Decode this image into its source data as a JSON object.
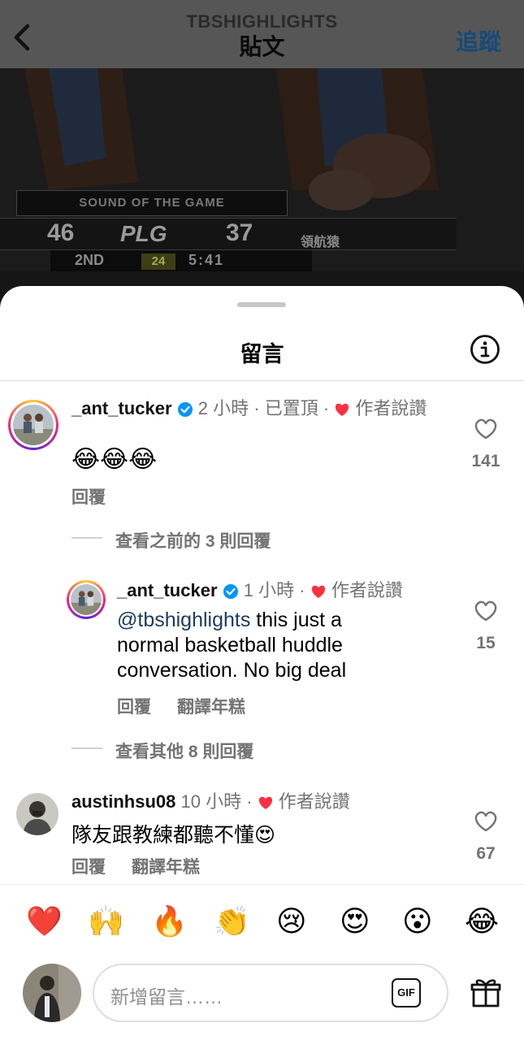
{
  "header": {
    "username": "TBSHIGHLIGHTS",
    "title": "貼文",
    "follow": "追蹤"
  },
  "video": {
    "banner": "SOUND OF THE GAME",
    "score_left": "46",
    "league": "PLG",
    "score_right": "37",
    "team_right": "領航猿",
    "period": "2ND",
    "shot_clock": "24",
    "game_clock": "5:41"
  },
  "sheet": {
    "title": "留言"
  },
  "comments": [
    {
      "username": "_ant_tucker",
      "time": "2 小時",
      "pinned": "已置頂",
      "liked_by_author": "作者說讚",
      "text": "😂😂😂",
      "reply": "回覆",
      "likes": "141",
      "view_previous": "查看之前的 3 則回覆"
    },
    {
      "username": "_ant_tucker",
      "time": "1 小時",
      "liked_by_author": "作者說讚",
      "mention": "@tbshighlights",
      "text_line1": " this just a",
      "text_line2": "normal basketball huddle",
      "text_line3": "conversation. No big deal",
      "reply": "回覆",
      "translate": "翻譯年糕",
      "likes": "15",
      "view_more": "查看其他 8 則回覆"
    },
    {
      "username": "austinhsu08",
      "time": "10 小時",
      "liked_by_author": "作者說讚",
      "text": "隊友跟教練都聽不懂😍",
      "reply": "回覆",
      "translate": "翻譯年糕",
      "likes": "67"
    }
  ],
  "emoji_bar": [
    "❤️",
    "🙌",
    "🔥",
    "👏",
    "😢",
    "😍",
    "😮",
    "😂"
  ],
  "composer": {
    "placeholder": "新增留言……",
    "gif": "GIF"
  },
  "colors": {
    "heart_red": "#ff3040",
    "verified_blue": "#0095f6",
    "mention_blue": "#1c3a5e",
    "secondary_gray": "#737373"
  }
}
